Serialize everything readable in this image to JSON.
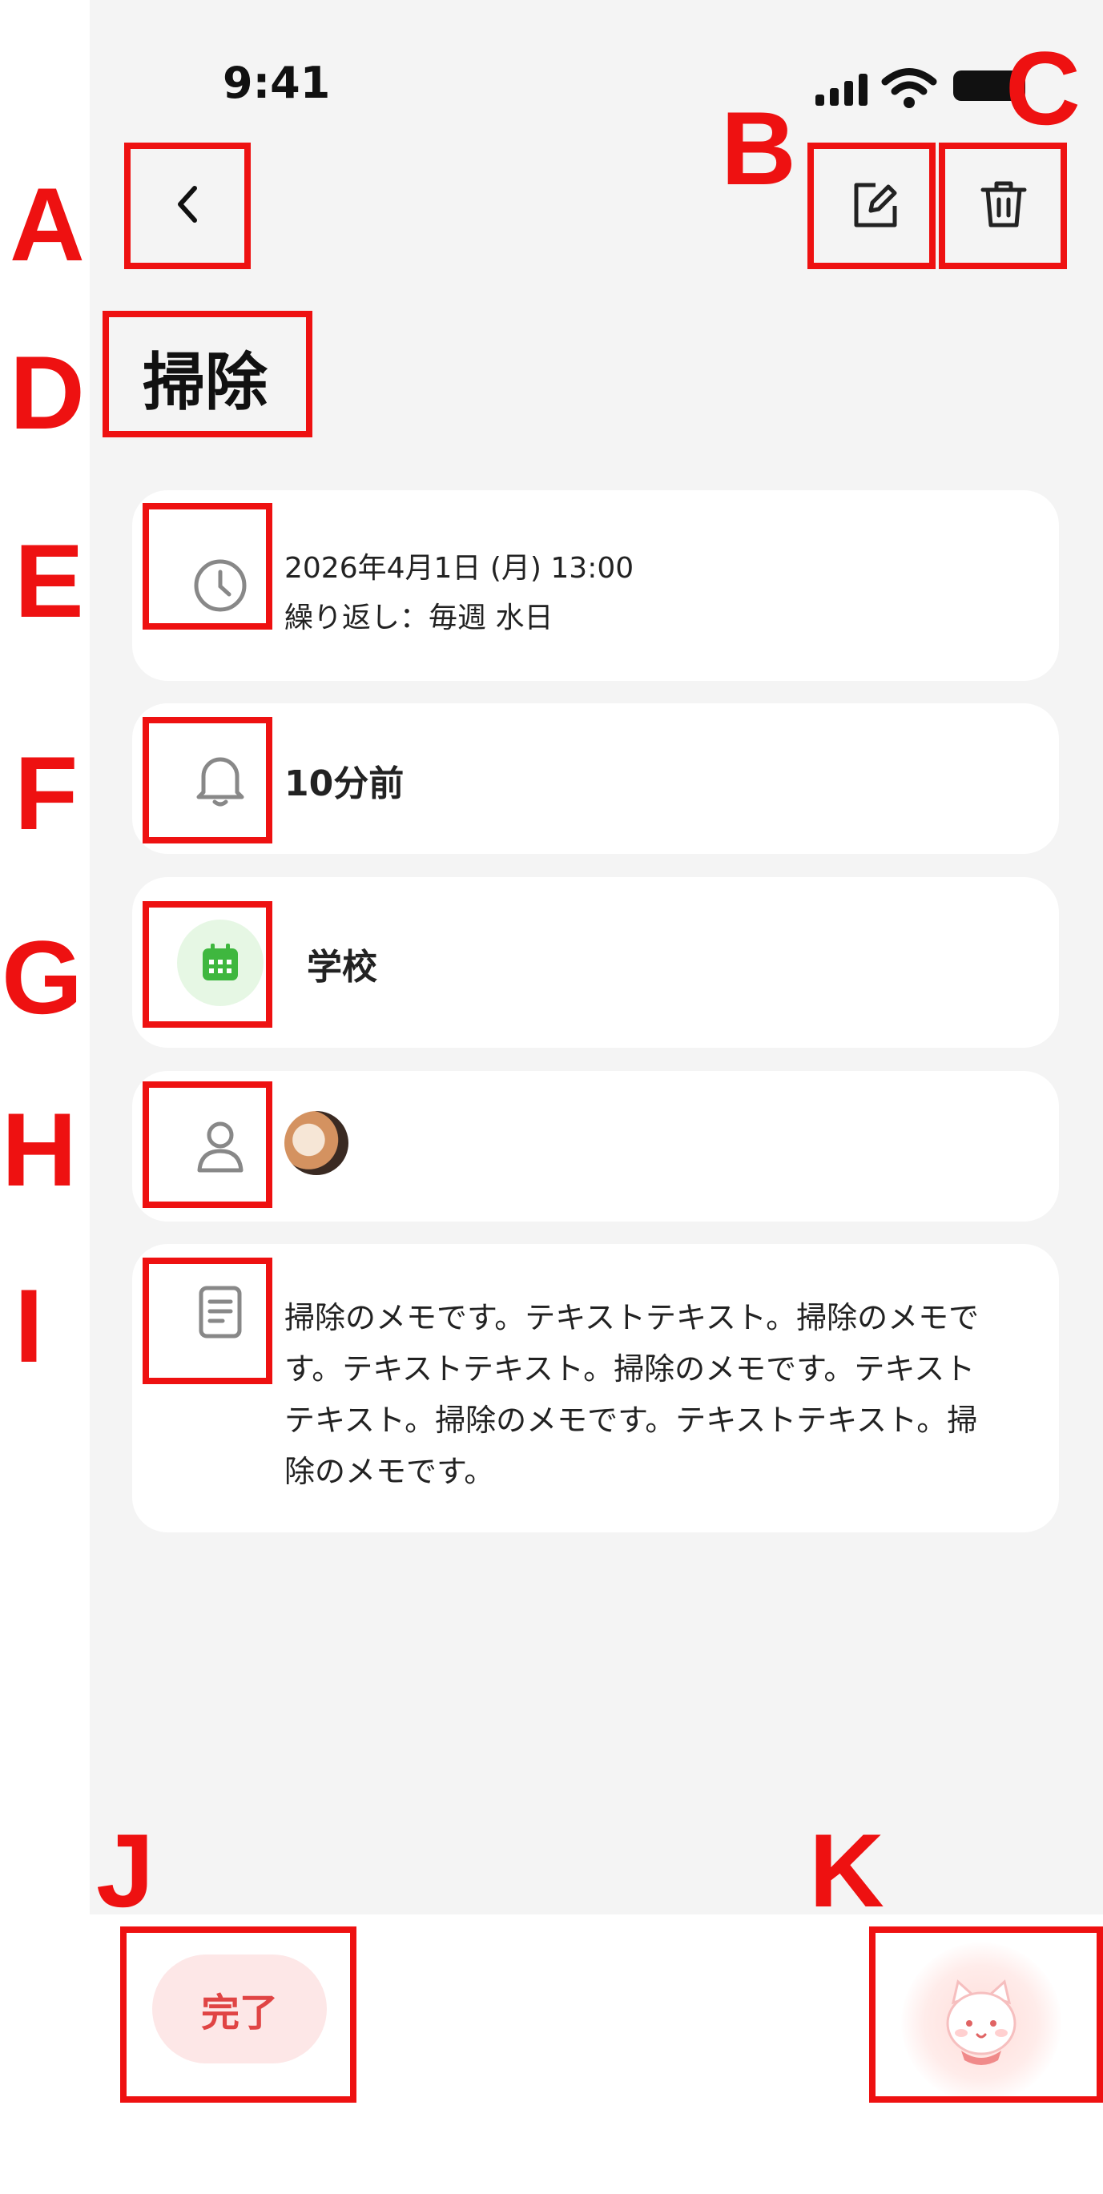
{
  "status_bar": {
    "time": "9:41"
  },
  "header": {
    "title": "掃除"
  },
  "cards": {
    "datetime": {
      "line1": "2026年4月1日 (月) 13:00",
      "line2": "繰り返し：毎週 水日"
    },
    "reminder": {
      "value": "10分前"
    },
    "calendar": {
      "name": "学校",
      "color": "#3fb73f"
    },
    "assignee": {},
    "memo": {
      "text": "掃除のメモです。テキストテキスト。掃除のメモです。テキストテキスト。掃除のメモです。テキストテキスト。掃除のメモです。テキストテキスト。掃除のメモです。"
    }
  },
  "bottom": {
    "done_label": "完了"
  },
  "annotations": {
    "a": "A",
    "b": "B",
    "c": "C",
    "d": "D",
    "e": "E",
    "f": "F",
    "g": "G",
    "h": "H",
    "i": "I",
    "j": "J",
    "k": "K"
  },
  "colors": {
    "accent": "#e04444",
    "annotation": "#ee1111",
    "background": "#f4f4f4"
  }
}
